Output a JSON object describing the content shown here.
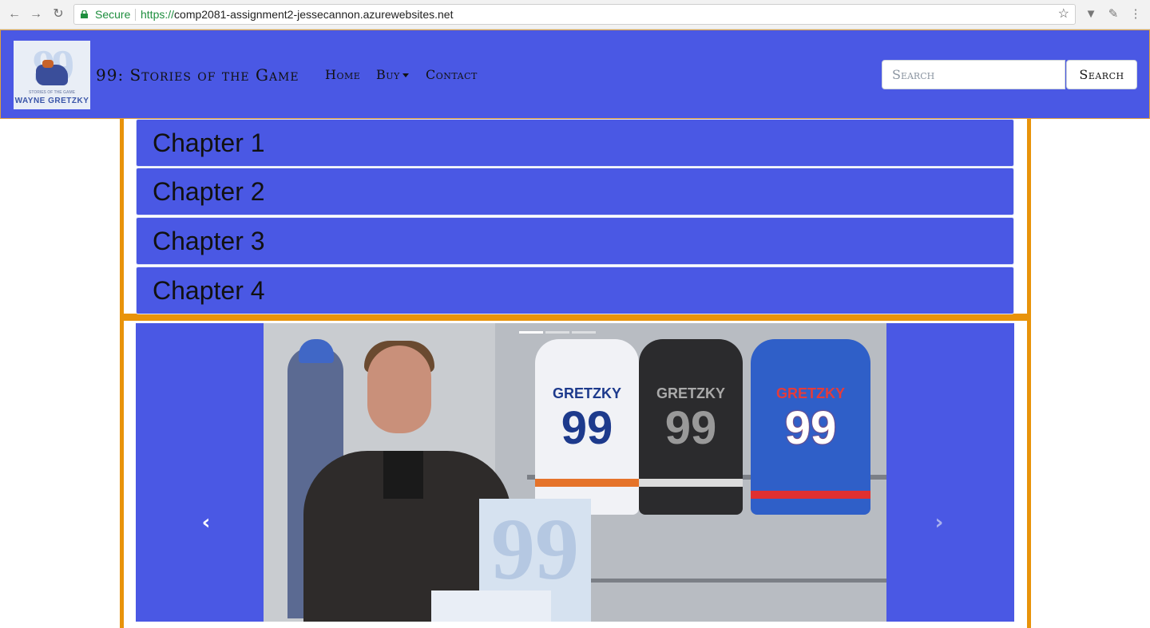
{
  "browser": {
    "secure_label": "Secure",
    "url_protocol": "https://",
    "url_host": "comp2081-assignment2-jessecannon.azurewebsites.net"
  },
  "navbar": {
    "brand": "99: Stories of the Game",
    "logo": {
      "number": "99",
      "subtitle": "STORIES OF THE GAME",
      "name": "WAYNE GRETZKY"
    },
    "links": [
      {
        "label": "Home"
      },
      {
        "label": "Buy"
      },
      {
        "label": "Contact"
      }
    ],
    "search": {
      "placeholder": "Search",
      "button_label": "Search"
    }
  },
  "chapters": [
    {
      "title": "Chapter 1"
    },
    {
      "title": "Chapter 2"
    },
    {
      "title": "Chapter 3"
    },
    {
      "title": "Chapter 4"
    }
  ],
  "carousel": {
    "jerseys": [
      {
        "name": "GRETZKY",
        "number": "99"
      },
      {
        "name": "GRETZKY",
        "number": "99"
      },
      {
        "name": "GRETZKY",
        "number": "99"
      }
    ],
    "poster_number": "99",
    "active_slide": 1,
    "slide_count": 3
  },
  "colors": {
    "brand_blue": "#4a58e4",
    "accent_orange": "#e8930a"
  }
}
